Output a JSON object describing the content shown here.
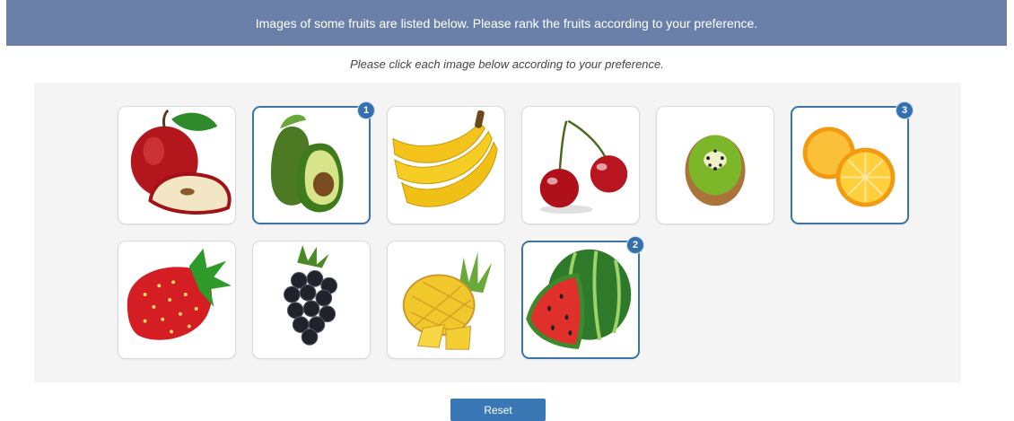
{
  "header": {
    "title": "Images of some fruits are listed below. Please rank the fruits according to your preference."
  },
  "instruction": "Please click each image below according to your preference.",
  "fruits": [
    {
      "name": "apple",
      "rank": null
    },
    {
      "name": "avocado",
      "rank": "1"
    },
    {
      "name": "banana",
      "rank": null
    },
    {
      "name": "cherry",
      "rank": null
    },
    {
      "name": "kiwi",
      "rank": null
    },
    {
      "name": "orange",
      "rank": "3"
    },
    {
      "name": "strawberry",
      "rank": null
    },
    {
      "name": "blackberry",
      "rank": null
    },
    {
      "name": "pineapple",
      "rank": null
    },
    {
      "name": "watermelon",
      "rank": "2"
    }
  ],
  "reset_label": "Reset",
  "colors": {
    "header_bg": "#6b80a8",
    "selected_border": "#3d74a6",
    "badge_bg": "#3470ad",
    "button_bg": "#3a78b5"
  }
}
